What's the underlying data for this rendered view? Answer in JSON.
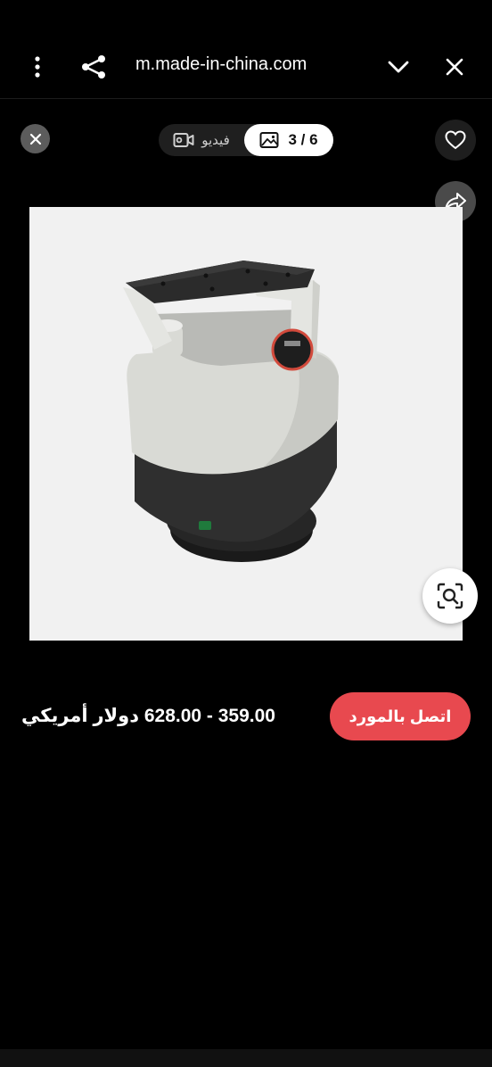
{
  "browser": {
    "url": "m.made-in-china.com"
  },
  "gallery": {
    "video_label": "فيديو",
    "counter": "3 / 6",
    "image_alt_icon": "product-image"
  },
  "product": {
    "price": "359.00 - 628.00 دولار أمريكي",
    "contact_label": "اتصل بالمورد"
  },
  "colors": {
    "accent": "#e8494f",
    "background": "#000000"
  }
}
